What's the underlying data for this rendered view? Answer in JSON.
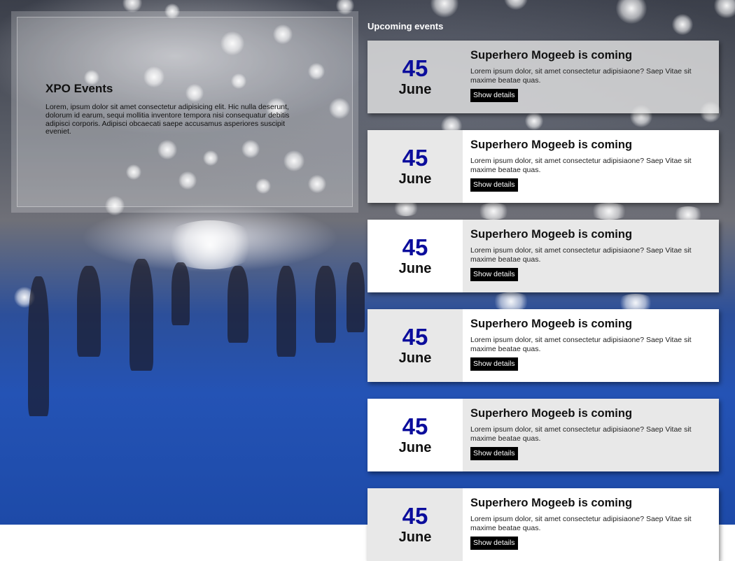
{
  "hero": {
    "title": "XPO Events",
    "description": "Lorem, ipsum dolor sit amet consectetur adipisicing elit. Hic nulla deserunt, dolorum id earum, sequi mollitia inventore tempora nisi consequatur debitis adipisci corporis. Adipisci obcaecati saepe accusamus asperiores suscipit eveniet."
  },
  "events": {
    "heading": "Upcoming events",
    "items": [
      {
        "day": "45",
        "month": "June",
        "title": "Superhero Mogeeb is coming",
        "description": "Lorem ipsum dolor, sit amet consectetur adipisiaone? Saep Vitae sit maxime beatae quas.",
        "button": "Show details"
      },
      {
        "day": "45",
        "month": "June",
        "title": "Superhero Mogeeb is coming",
        "description": "Lorem ipsum dolor, sit amet consectetur adipisiaone? Saep Vitae sit maxime beatae quas.",
        "button": "Show details"
      },
      {
        "day": "45",
        "month": "June",
        "title": "Superhero Mogeeb is coming",
        "description": "Lorem ipsum dolor, sit amet consectetur adipisiaone? Saep Vitae sit maxime beatae quas.",
        "button": "Show details"
      },
      {
        "day": "45",
        "month": "June",
        "title": "Superhero Mogeeb is coming",
        "description": "Lorem ipsum dolor, sit amet consectetur adipisiaone? Saep Vitae sit maxime beatae quas.",
        "button": "Show details"
      },
      {
        "day": "45",
        "month": "June",
        "title": "Superhero Mogeeb is coming",
        "description": "Lorem ipsum dolor, sit amet consectetur adipisiaone? Saep Vitae sit maxime beatae quas.",
        "button": "Show details"
      },
      {
        "day": "45",
        "month": "June",
        "title": "Superhero Mogeeb is coming",
        "description": "Lorem ipsum dolor, sit amet consectetur adipisiaone? Saep Vitae sit maxime beatae quas.",
        "button": "Show details"
      }
    ]
  },
  "colors": {
    "date_day": "#0b0d9c",
    "button_bg": "#000000",
    "card_grey": "#e8e8e8",
    "card_white": "#ffffff"
  }
}
